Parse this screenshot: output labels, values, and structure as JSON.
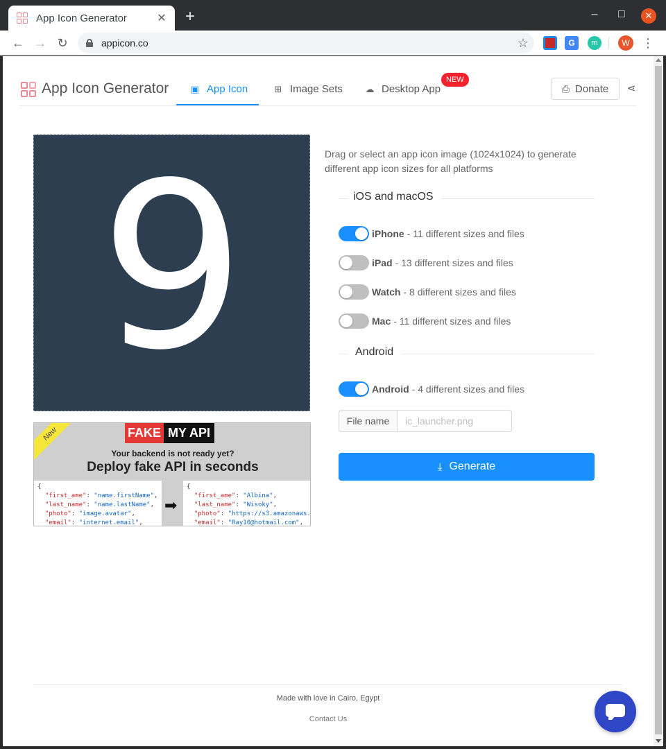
{
  "browser": {
    "tab_title": "App Icon Generator",
    "tab_close": "✕",
    "new_tab": "+",
    "url": "appicon.co",
    "avatar_initial": "W",
    "extensions": [
      "bookmark-ext-icon",
      "google-translate-icon",
      "m-ext-icon"
    ],
    "ext_translate_label": "G",
    "ext_m_label": "m",
    "window_controls": {
      "minimize": "–",
      "maximize": "□",
      "close": "✕"
    },
    "menu": "⋮"
  },
  "header": {
    "brand": "App Icon Generator",
    "tabs": [
      {
        "label": "App Icon",
        "icon": "image-icon",
        "active": true
      },
      {
        "label": "Image Sets",
        "icon": "grid-icon",
        "active": false
      },
      {
        "label": "Desktop App",
        "icon": "cloud-download-icon",
        "active": false,
        "badge": "NEW"
      }
    ],
    "donate_label": "Donate"
  },
  "preview": {
    "glyph": "9",
    "background_color": "#2c3e50"
  },
  "ad": {
    "ribbon": "New",
    "logo_fake": "FAKE",
    "logo_api": "MY API",
    "subtitle": "Your backend is not ready yet?",
    "headline": "Deploy fake API in seconds"
  },
  "main": {
    "description": "Drag or select an app icon image (1024x1024) to generate different app icon sizes for all platforms",
    "ios_section": "iOS and macOS",
    "android_section": "Android",
    "platforms": [
      {
        "name": "iPhone",
        "detail": "- 11 different sizes and files",
        "enabled": true
      },
      {
        "name": "iPad",
        "detail": "- 13 different sizes and files",
        "enabled": false
      },
      {
        "name": "Watch",
        "detail": "- 8 different sizes and files",
        "enabled": false
      },
      {
        "name": "Mac",
        "detail": "- 11 different sizes and files",
        "enabled": false
      },
      {
        "name": "Android",
        "detail": "- 4 different sizes and files",
        "enabled": true
      }
    ],
    "filename_label": "File name",
    "filename_placeholder": "ic_launcher.png",
    "filename_value": "",
    "generate_label": "Generate"
  },
  "footer": {
    "made_with": "Made with love in Cairo, Egypt",
    "contact": "Contact Us"
  },
  "colors": {
    "accent": "#1890ff",
    "badge": "#f5222d",
    "chat": "#2f46c6"
  }
}
